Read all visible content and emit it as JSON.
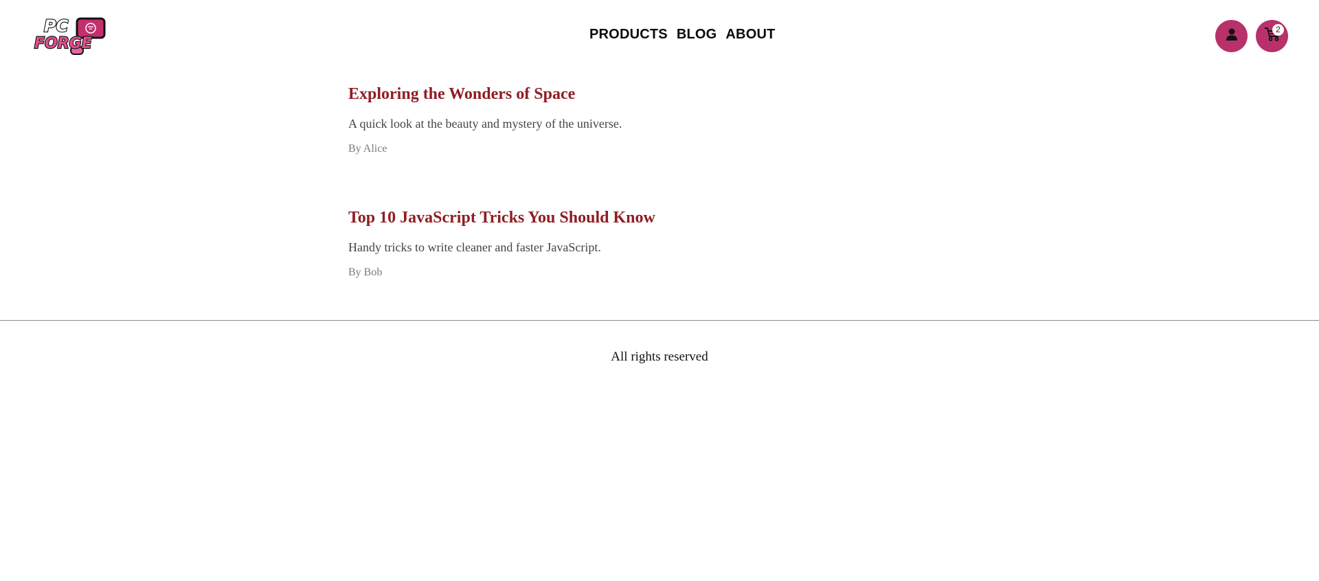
{
  "header": {
    "logo_icon": "pc-forge-logo",
    "nav": [
      "PRODUCTS",
      "BLOG",
      "ABOUT"
    ],
    "user_icon": "user-icon",
    "cart_icon": "cart-icon",
    "cart_count": "2",
    "accent_color": "#b8316a"
  },
  "posts": [
    {
      "title": "Exploring the Wonders of Space",
      "description": "A quick look at the beauty and mystery of the universe.",
      "author": "By Alice"
    },
    {
      "title": "Top 10 JavaScript Tricks You Should Know",
      "description": "Handy tricks to write cleaner and faster JavaScript.",
      "author": "By Bob"
    }
  ],
  "footer": {
    "text": "All rights reserved"
  },
  "colors": {
    "title": "#8f1d23",
    "description": "#444444",
    "author": "#7a7a7a"
  }
}
